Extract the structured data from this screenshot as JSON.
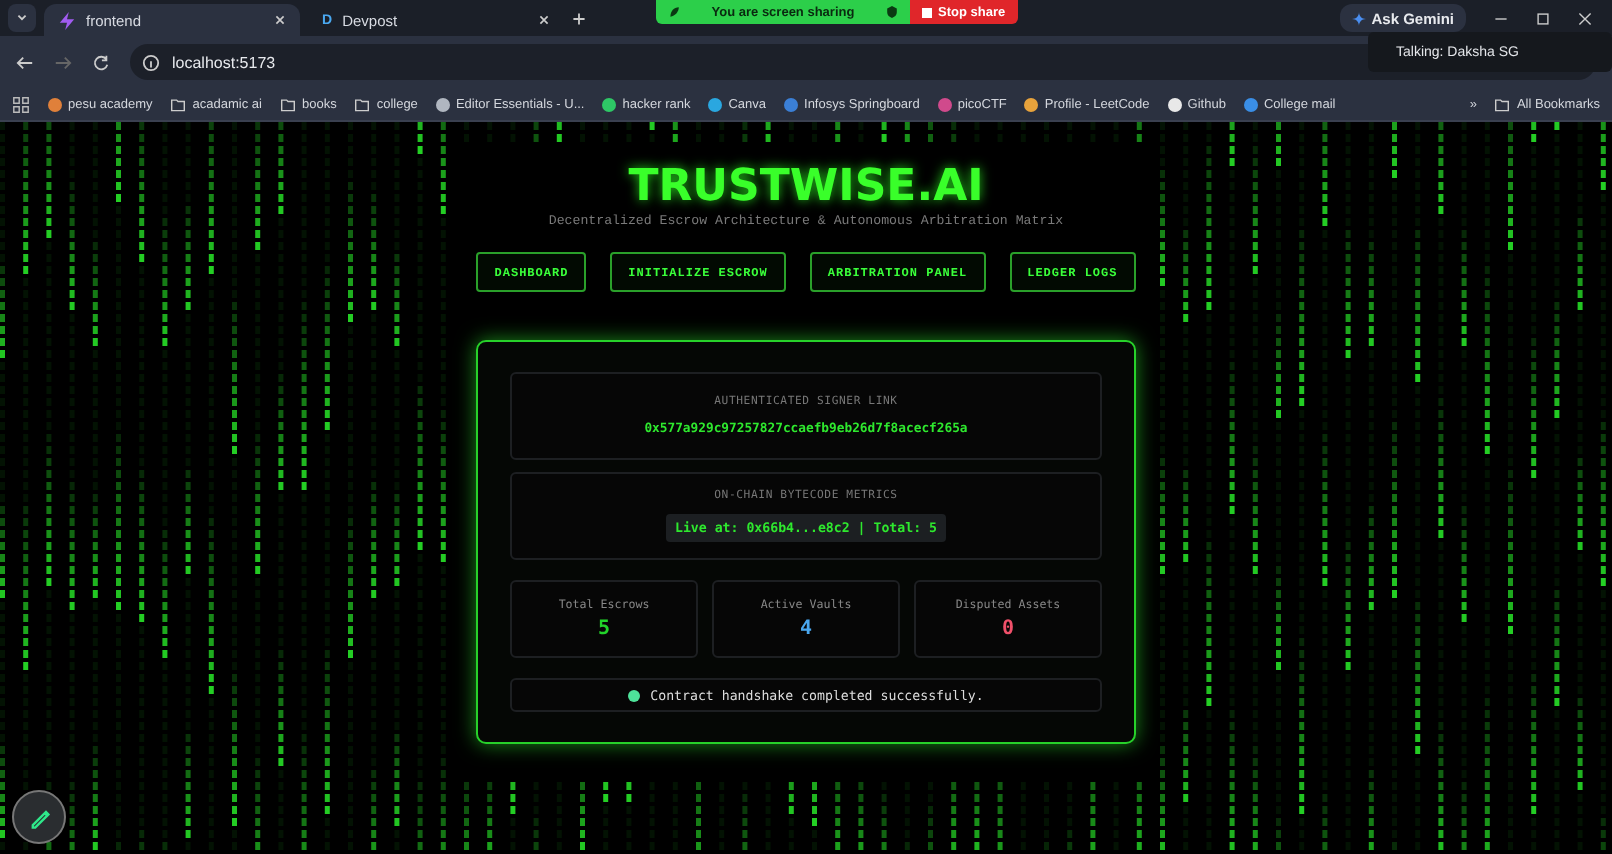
{
  "browser": {
    "tabs": [
      {
        "title": "frontend",
        "selected": true
      },
      {
        "title": "Devpost",
        "selected": false,
        "letter": "D"
      }
    ],
    "share_bar": {
      "message": "You are screen sharing",
      "stop": "Stop share"
    },
    "ask_button": "Ask Gemini",
    "tooltip": "Talking: Daksha SG",
    "address": "localhost:5173",
    "bookmarks": [
      {
        "label": "pesu academy",
        "kind": "site",
        "color": "#e0803a"
      },
      {
        "label": "acadamic ai",
        "kind": "folder"
      },
      {
        "label": "books",
        "kind": "folder"
      },
      {
        "label": "college",
        "kind": "folder"
      },
      {
        "label": "Editor Essentials - U...",
        "kind": "site",
        "color": "#b0b6c0"
      },
      {
        "label": "hacker rank",
        "kind": "site",
        "color": "#2ec866"
      },
      {
        "label": "Canva",
        "kind": "site",
        "color": "#2aa7e0"
      },
      {
        "label": "Infosys Springboard",
        "kind": "site",
        "color": "#3b7fd6"
      },
      {
        "label": "picoCTF",
        "kind": "site",
        "color": "#d04a8c"
      },
      {
        "label": "Profile - LeetCode",
        "kind": "site",
        "color": "#e8a33c"
      },
      {
        "label": "Github",
        "kind": "site",
        "color": "#e8e8e8"
      },
      {
        "label": "College mail",
        "kind": "site",
        "color": "#3a8ee6"
      }
    ],
    "more": "»",
    "all_bookmarks": "All Bookmarks"
  },
  "page": {
    "title": "TRUSTWISE.AI",
    "subtitle": "Decentralized Escrow Architecture & Autonomous Arbitration Matrix",
    "nav": [
      {
        "label": "DASHBOARD",
        "selected": false
      },
      {
        "label": "INITIALIZE ESCROW",
        "selected": false
      },
      {
        "label": "ARBITRATION PANEL",
        "selected": false
      },
      {
        "label": "LEDGER LOGS",
        "selected": false
      }
    ],
    "signer": {
      "label": "AUTHENTICATED SIGNER LINK",
      "address": "0x577a929c97257827ccaefb9eb26d7f8acecf265a"
    },
    "metrics": {
      "label": "ON-CHAIN BYTECODE METRICS",
      "value": "Live at: 0x66b4...e8c2 | Total: 5"
    },
    "stats": [
      {
        "label": "Total Escrows",
        "value": "5",
        "color": "#22d32a"
      },
      {
        "label": "Active Vaults",
        "value": "4",
        "color": "#4aa8f0"
      },
      {
        "label": "Disputed Assets",
        "value": "0",
        "color": "#f0506a"
      }
    ],
    "status": {
      "message": "Contract handshake completed successfully.",
      "color": "#4ee39a"
    }
  }
}
